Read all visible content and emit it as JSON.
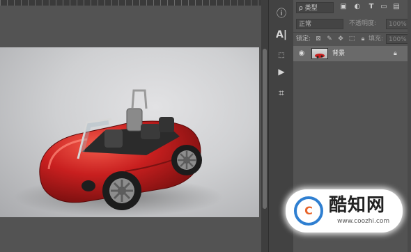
{
  "panel": {
    "filter_kind": "ρ 类型",
    "blend_mode": "正常",
    "opacity_label": "不透明度:",
    "opacity_value": "100%",
    "lock_label": "锁定:",
    "fill_label": "填充:",
    "fill_value": "100%",
    "layer": {
      "name": "背景",
      "visible": true,
      "locked": true
    }
  },
  "icons": {
    "filter": [
      "image-filter-icon",
      "adjustment-filter-icon",
      "type-filter-icon",
      "shape-filter-icon",
      "smart-object-filter-icon"
    ],
    "tools": [
      "info-icon",
      "character-icon",
      "3d-icon",
      "play-icon",
      "crop-icon"
    ],
    "locks": [
      "lock-pixels-icon",
      "lock-paint-icon",
      "lock-position-icon",
      "lock-artboard-icon",
      "lock-all-icon"
    ]
  },
  "watermark": {
    "logo_text": "C",
    "title": "酷知网",
    "url": "www.coozhi.com"
  },
  "colors": {
    "panel_bg": "#535353",
    "layer_selected": "#6a6a6a",
    "car_red": "#c81f1f",
    "watermark_blue": "#2f7fd1",
    "watermark_orange": "#e8642a"
  }
}
